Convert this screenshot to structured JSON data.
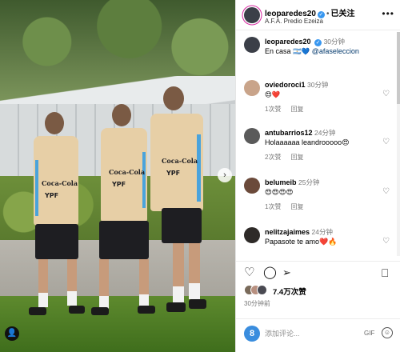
{
  "post": {
    "username": "leoparedes20",
    "follow_status": "已关注",
    "location": "A.F.A. Predio Ezeiza",
    "caption": {
      "username": "leoparedes20",
      "time": "30分钟",
      "text": "En casa",
      "flag": "🇦🇷💙",
      "mention": "@afaseleccion"
    }
  },
  "jersey": {
    "sponsor": "Coca-Cola",
    "brand": "YPF"
  },
  "comments": [
    {
      "username": "oviedoroci1",
      "time": "30分钟",
      "text": "😍❤️",
      "likes": "1次赞",
      "reply": "回复"
    },
    {
      "username": "antubarrios12",
      "time": "24分钟",
      "text": "Holaaaaaa leandrooooo😍",
      "likes": "2次赞",
      "reply": "回复"
    },
    {
      "username": "belumeib",
      "time": "25分钟",
      "text": "😍😍😍😍",
      "likes": "1次赞",
      "reply": "回复"
    },
    {
      "username": "nelitzajaimes",
      "time": "24分钟",
      "text": "Papasote te amo❤️🔥",
      "likes": "",
      "reply": ""
    }
  ],
  "likes_count": "7.4万次赞",
  "posted_time": "30分钟前",
  "composer": {
    "placeholder": "添加评论...",
    "avatar_letter": "8",
    "gif": "GIF"
  },
  "colors": {
    "verified": "#3897f0",
    "mention": "#00376b",
    "shirt": "#e7cfa6",
    "stripe": "#4aa3dc"
  },
  "icons": {
    "more": "more-dots-icon",
    "heart": "heart-icon",
    "comment": "comment-icon",
    "share": "share-icon",
    "save": "bookmark-icon",
    "next": "chevron-right-icon",
    "tag": "user-tag-icon"
  }
}
